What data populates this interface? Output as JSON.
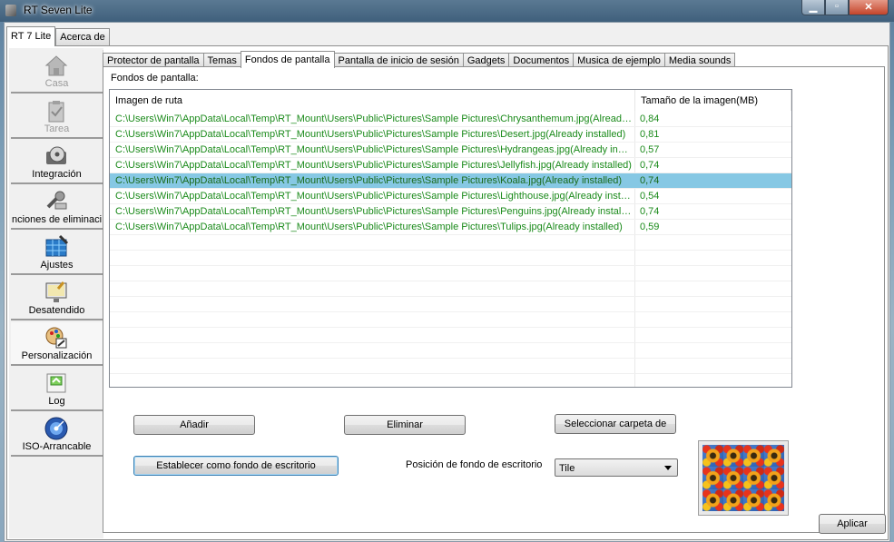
{
  "window": {
    "title": "RT Seven Lite",
    "controls": {
      "minimize": "minimize",
      "maximize": "maximize",
      "close": "close"
    }
  },
  "top_tabs": [
    {
      "label": "RT 7 Lite",
      "active": true
    },
    {
      "label": "Acerca de",
      "active": false
    }
  ],
  "sidebar": {
    "items": [
      {
        "label": "Casa",
        "icon": "house-icon",
        "enabled": false
      },
      {
        "label": "Tarea",
        "icon": "clipboard-icon",
        "enabled": false
      },
      {
        "label": "Integración",
        "icon": "disc-drive-icon",
        "enabled": true
      },
      {
        "label": "nciones de eliminaci",
        "icon": "tools-icon",
        "enabled": true
      },
      {
        "label": "Ajustes",
        "icon": "settings-grid-icon",
        "enabled": true
      },
      {
        "label": "Desatendido",
        "icon": "monitor-icon",
        "enabled": true
      },
      {
        "label": "Personalización",
        "icon": "palette-icon",
        "enabled": true
      },
      {
        "label": "Log",
        "icon": "log-icon",
        "enabled": true
      },
      {
        "label": "ISO-Arrancable",
        "icon": "cd-icon",
        "enabled": true
      }
    ]
  },
  "inner_tabs": [
    {
      "label": "Protector de pantalla",
      "active": false
    },
    {
      "label": "Temas",
      "active": false
    },
    {
      "label": "Fondos de pantalla",
      "active": true
    },
    {
      "label": "Pantalla de inicio de sesión",
      "active": false
    },
    {
      "label": "Gadgets",
      "active": false
    },
    {
      "label": "Documentos",
      "active": false
    },
    {
      "label": "Musica de ejemplo",
      "active": false
    },
    {
      "label": "Media sounds",
      "active": false
    }
  ],
  "wallpapers": {
    "section_label": "Fondos de pantalla:",
    "columns": [
      "Imagen de ruta",
      "Tamaño de la imagen(MB)"
    ],
    "rows": [
      {
        "path": "C:\\Users\\Win7\\AppData\\Local\\Temp\\RT_Mount\\Users\\Public\\Pictures\\Sample Pictures\\Chrysanthemum.jpg(Alread…",
        "size": "0,84",
        "selected": false
      },
      {
        "path": "C:\\Users\\Win7\\AppData\\Local\\Temp\\RT_Mount\\Users\\Public\\Pictures\\Sample Pictures\\Desert.jpg(Already installed)",
        "size": "0,81",
        "selected": false
      },
      {
        "path": "C:\\Users\\Win7\\AppData\\Local\\Temp\\RT_Mount\\Users\\Public\\Pictures\\Sample Pictures\\Hydrangeas.jpg(Already in…",
        "size": "0,57",
        "selected": false
      },
      {
        "path": "C:\\Users\\Win7\\AppData\\Local\\Temp\\RT_Mount\\Users\\Public\\Pictures\\Sample Pictures\\Jellyfish.jpg(Already installed)",
        "size": "0,74",
        "selected": false
      },
      {
        "path": "C:\\Users\\Win7\\AppData\\Local\\Temp\\RT_Mount\\Users\\Public\\Pictures\\Sample Pictures\\Koala.jpg(Already installed)",
        "size": "0,74",
        "selected": true
      },
      {
        "path": "C:\\Users\\Win7\\AppData\\Local\\Temp\\RT_Mount\\Users\\Public\\Pictures\\Sample Pictures\\Lighthouse.jpg(Already inst…",
        "size": "0,54",
        "selected": false
      },
      {
        "path": "C:\\Users\\Win7\\AppData\\Local\\Temp\\RT_Mount\\Users\\Public\\Pictures\\Sample Pictures\\Penguins.jpg(Already install…",
        "size": "0,74",
        "selected": false
      },
      {
        "path": "C:\\Users\\Win7\\AppData\\Local\\Temp\\RT_Mount\\Users\\Public\\Pictures\\Sample Pictures\\Tulips.jpg(Already installed)",
        "size": "0,59",
        "selected": false
      }
    ],
    "empty_rows": 10
  },
  "buttons": {
    "add": "Añadir",
    "remove": "Eliminar",
    "select_folder": "Seleccionar carpeta de",
    "set_desktop": "Establecer como fondo de escritorio",
    "apply": "Aplicar"
  },
  "position": {
    "label": "Posición de fondo de escritorio",
    "selected": "Tile"
  },
  "colors": {
    "list_text": "#1a8a1a",
    "selected_row": "#86c8e4"
  }
}
